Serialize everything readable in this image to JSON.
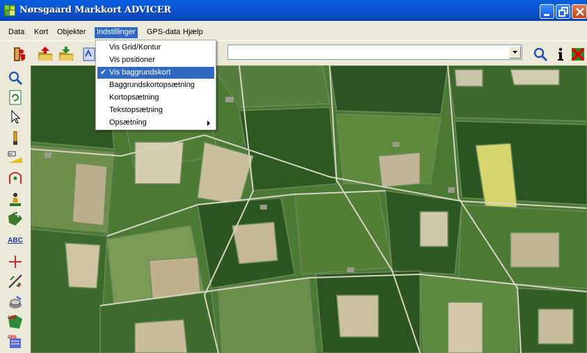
{
  "window": {
    "title": "Nørsgaard Markkort ADVICER"
  },
  "menubar": {
    "items": [
      {
        "label": "Data"
      },
      {
        "label": "Kort"
      },
      {
        "label": "Objekter"
      },
      {
        "label": "Indstillinger",
        "active": true
      },
      {
        "label": "GPS-data"
      },
      {
        "label": "Hjælp"
      }
    ]
  },
  "dropdown": {
    "items": [
      {
        "label": "Vis Grid/Kontur",
        "checked": false
      },
      {
        "label": "Vis positioner",
        "checked": false
      },
      {
        "label": "Vis baggrundskort",
        "checked": true,
        "highlighted": true
      },
      {
        "label": "Baggrundskortopsætning",
        "checked": false
      },
      {
        "label": "Kortopsætning",
        "checked": false
      },
      {
        "label": "Tekstopsætning",
        "checked": false
      },
      {
        "label": "Opsætning",
        "checked": false,
        "submenu": true
      }
    ],
    "check_glyph": "✔"
  },
  "toolbar": {
    "combo_value": "",
    "combo_label_fragment": "b",
    "icons": [
      "exit-icon",
      "open-folder-icon",
      "save-folder-icon",
      "layers-icon",
      "zoom-search-icon",
      "info-icon",
      "delete-icon"
    ]
  },
  "leftbar": {
    "icons": [
      "zoom-icon",
      "refresh-icon",
      "pointer-icon",
      "marker-pin-icon",
      "measure-area-icon",
      "route-icon",
      "person-icon",
      "field-add-icon",
      "text-abc-icon",
      "crosshair-icon",
      "split-icon",
      "gps-receiver-icon",
      "gps-map-icon",
      "gps-data-icon"
    ],
    "abc_label": "ABC"
  },
  "colors": {
    "title_bar": "#0a5fdb",
    "menu_highlight": "#316ac5",
    "chrome": "#ece9d8"
  }
}
